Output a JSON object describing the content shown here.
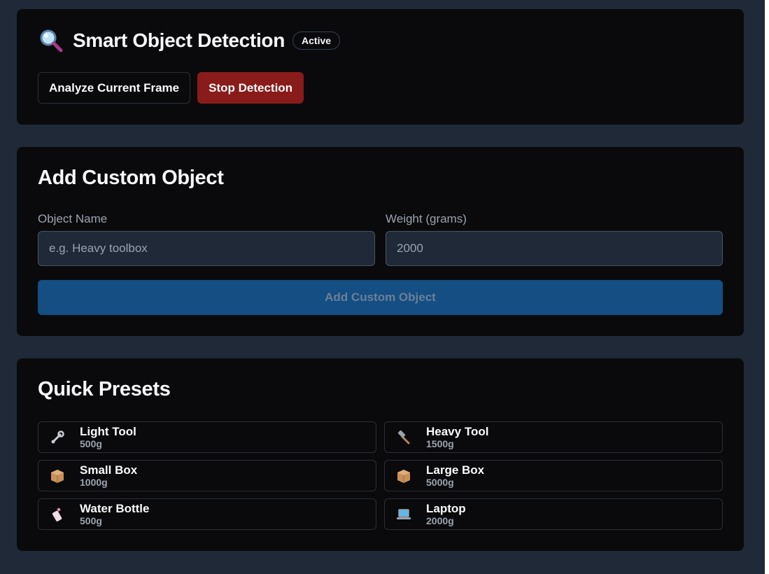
{
  "detection": {
    "title": "Smart Object Detection",
    "status_badge": "Active",
    "analyze_label": "Analyze Current Frame",
    "stop_label": "Stop Detection"
  },
  "custom": {
    "title": "Add Custom Object",
    "name_label": "Object Name",
    "name_placeholder": "e.g. Heavy toolbox",
    "weight_label": "Weight (grams)",
    "weight_value": "2000",
    "add_label": "Add Custom Object"
  },
  "presets": {
    "title": "Quick Presets",
    "items": [
      {
        "name": "Light Tool",
        "weight": "500g",
        "icon": "wrench-icon"
      },
      {
        "name": "Heavy Tool",
        "weight": "1500g",
        "icon": "hammer-icon"
      },
      {
        "name": "Small Box",
        "weight": "1000g",
        "icon": "box-icon"
      },
      {
        "name": "Large Box",
        "weight": "5000g",
        "icon": "box-icon"
      },
      {
        "name": "Water Bottle",
        "weight": "500g",
        "icon": "bottle-icon"
      },
      {
        "name": "Laptop",
        "weight": "2000g",
        "icon": "laptop-icon"
      }
    ]
  },
  "colors": {
    "page_bg": "#1f2937",
    "card_bg": "#0a0a0c",
    "danger": "#8a1b1b",
    "primary": "#144e82"
  }
}
